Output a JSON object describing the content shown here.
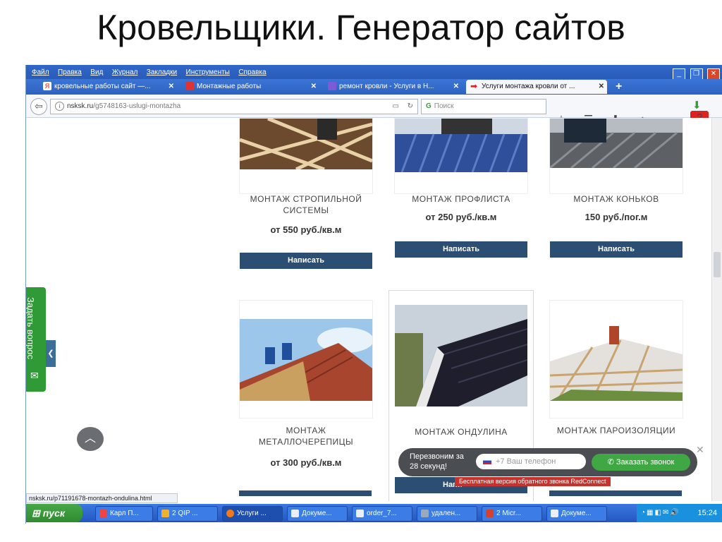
{
  "slide": {
    "title": "Кровельщики. Генератор сайтов"
  },
  "menubar": {
    "items": [
      "Файл",
      "Правка",
      "Вид",
      "Журнал",
      "Закладки",
      "Инструменты",
      "Справка"
    ]
  },
  "tabs": [
    {
      "label": "кровельные работы сайт —...",
      "close": "✕"
    },
    {
      "label": "Монтажные работы",
      "close": "✕"
    },
    {
      "label": "ремонт кровли - Услуги в Н...",
      "close": "✕"
    },
    {
      "label": "Услуги монтажа кровли от ...",
      "close": "✕"
    }
  ],
  "new_tab": "+",
  "navbar": {
    "url_host": "nsksk.ru",
    "url_path": "/g5748163-uslugi-montazha",
    "search_placeholder": "Поиск",
    "badge": "2"
  },
  "products": [
    {
      "name": "МОНТАЖ СТРОПИЛЬНОЙ СИСТЕМЫ",
      "price": "от 550 руб./кв.м",
      "button": "Написать"
    },
    {
      "name": "МОНТАЖ ПРОФЛИСТА",
      "price": "от 250 руб./кв.м",
      "button": "Написать"
    },
    {
      "name": "МОНТАЖ КОНЬКОВ",
      "price": "150 руб./пог.м",
      "button": "Написать"
    },
    {
      "name": "МОНТАЖ МЕТАЛЛОЧЕРЕПИЦЫ",
      "price": "от 300 руб./кв.м",
      "button": ""
    },
    {
      "name": "МОНТАЖ ОНДУЛИНА",
      "price": "",
      "button": "Напи"
    },
    {
      "name": "МОНТАЖ ПАРОИЗОЛЯЦИИ",
      "price": "",
      "button": ""
    }
  ],
  "ask_tab": {
    "label": "Задать вопрос"
  },
  "callback": {
    "text": "Перезвоним за 28 секунд!",
    "phone_placeholder": "+7 Ваш телефон",
    "call_button": "Заказать звонок",
    "note": "Бесплатная версия обратного звонка RedConnect"
  },
  "statusbar": {
    "url": "nsksk.ru/p71191678-montazh-ondulina.html"
  },
  "taskbar": {
    "start": "пуск",
    "tasks": [
      "Карл П...",
      "2 QIP ...",
      "Услуги ...",
      "Докуме...",
      "order_7...",
      "удален...",
      "2 Micr...",
      "Докуме..."
    ],
    "clock": "15:24"
  }
}
